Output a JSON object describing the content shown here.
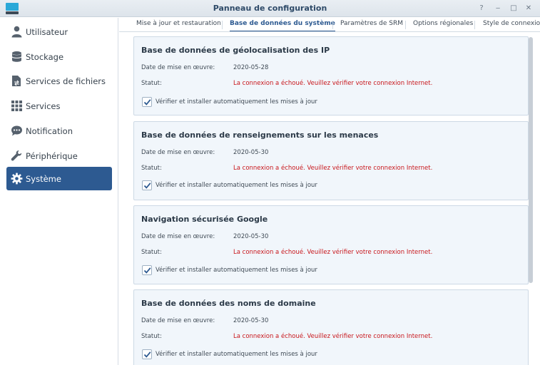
{
  "window": {
    "title": "Panneau de configuration",
    "controls": {
      "help": "?",
      "minimize": "‒",
      "maximize": "□",
      "close": "✕"
    }
  },
  "sidebar": {
    "items": [
      {
        "label": "Utilisateur",
        "icon": "user-icon"
      },
      {
        "label": "Stockage",
        "icon": "storage-icon"
      },
      {
        "label": "Services de fichiers",
        "icon": "file-services-icon"
      },
      {
        "label": "Services",
        "icon": "services-grid-icon"
      },
      {
        "label": "Notification",
        "icon": "notification-bubble-icon"
      },
      {
        "label": "Périphérique",
        "icon": "wrench-icon"
      },
      {
        "label": "Système",
        "icon": "gear-icon",
        "active": true
      }
    ]
  },
  "tabs": [
    {
      "label": "Mise à jour et restauration"
    },
    {
      "label": "Base de données du système",
      "active": true
    },
    {
      "label": "Paramètres de SRM"
    },
    {
      "label": "Options régionales"
    },
    {
      "label": "Style de connexion"
    }
  ],
  "labels": {
    "date": "Date de mise en œuvre:",
    "status": "Statut:",
    "auto_update": "Vérifier et installer automatiquement les mises à jour"
  },
  "panels": [
    {
      "title": "Base de données de géolocalisation des IP",
      "date": "2020-05-28",
      "status": "La connexion a échoué. Veuillez vérifier votre connexion Internet.",
      "auto_update_checked": true
    },
    {
      "title": "Base de données de renseignements sur les menaces",
      "date": "2020-05-30",
      "status": "La connexion a échoué. Veuillez vérifier votre connexion Internet.",
      "auto_update_checked": true
    },
    {
      "title": "Navigation sécurisée Google",
      "date": "2020-05-30",
      "status": "La connexion a échoué. Veuillez vérifier votre connexion Internet.",
      "auto_update_checked": true
    },
    {
      "title": "Base de données des noms de domaine",
      "date": "2020-05-30",
      "status": "La connexion a échoué. Veuillez vérifier votre connexion Internet.",
      "auto_update_checked": true
    }
  ],
  "colors": {
    "accent": "#2d5a91",
    "error": "#c8161b",
    "panel_bg": "#f1f6fb"
  }
}
